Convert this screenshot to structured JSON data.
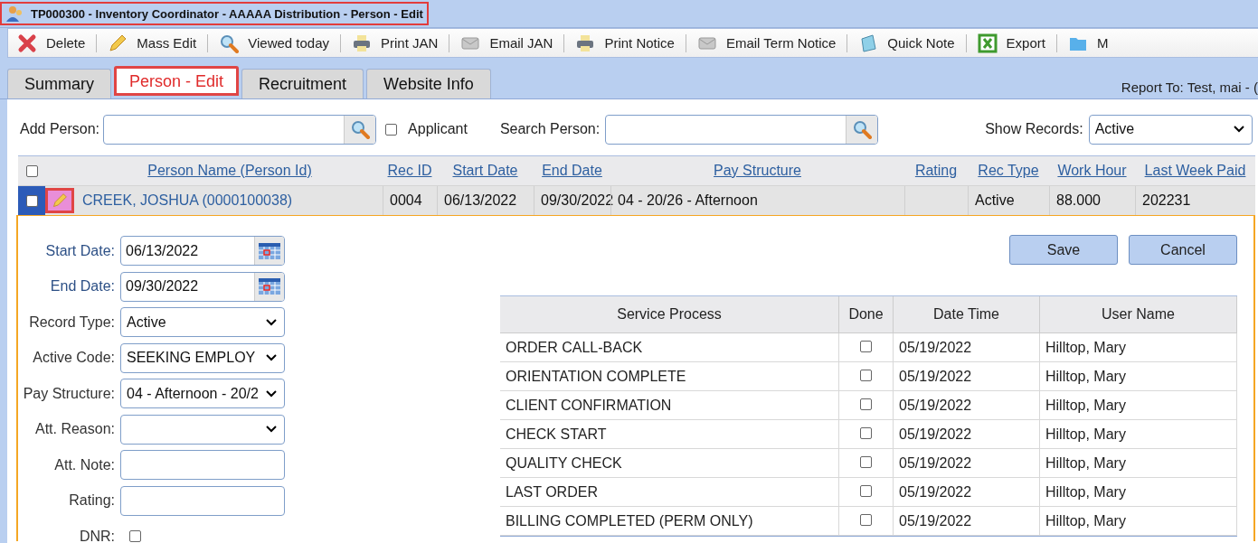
{
  "window": {
    "title": "TP000300 - Inventory Coordinator - AAAAA Distribution - Person - Edit"
  },
  "toolbar": [
    {
      "label": "Delete",
      "kind": "delete"
    },
    {
      "label": "Mass Edit",
      "kind": "edit"
    },
    {
      "label": "Viewed today",
      "kind": "search"
    },
    {
      "label": "Print JAN",
      "kind": "print"
    },
    {
      "label": "Email JAN",
      "kind": "email"
    },
    {
      "label": "Print Notice",
      "kind": "print"
    },
    {
      "label": "Email Term Notice",
      "kind": "email"
    },
    {
      "label": "Quick Note",
      "kind": "note"
    },
    {
      "label": "Export",
      "kind": "export"
    },
    {
      "label": "M",
      "kind": "folder"
    }
  ],
  "tabs": [
    {
      "label": "Summary",
      "selected": false
    },
    {
      "label": "Person - Edit",
      "selected": true
    },
    {
      "label": "Recruitment",
      "selected": false
    },
    {
      "label": "Website Info",
      "selected": false
    }
  ],
  "report_to": "Report To: Test, mai - (",
  "filters": {
    "add_person_label": "Add Person:",
    "applicant": {
      "label": "Applicant",
      "checked": false
    },
    "search_person_label": "Search Person:",
    "show_records_label": "Show Records:",
    "show_records_value": "Active"
  },
  "grid": {
    "header_checked": false,
    "columns": [
      "Person Name (Person Id)",
      "Rec ID",
      "Start Date",
      "End Date",
      "Pay Structure",
      "Rating",
      "Rec Type",
      "Work Hour",
      "Last Week Paid"
    ],
    "rows": [
      {
        "checked": false,
        "cells": [
          "CREEK, JOSHUA (0000100038)",
          "0004",
          "06/13/2022",
          "09/30/2022",
          "04 - 20/26 - Afternoon",
          "",
          "Active",
          "88.000",
          "202231"
        ]
      }
    ]
  },
  "edit_form": {
    "fields": [
      {
        "label": "Start Date:",
        "kind": "date",
        "value": "06/13/2022"
      },
      {
        "label": "End Date:",
        "kind": "date",
        "value": "09/30/2022"
      },
      {
        "label": "Record Type:",
        "kind": "select",
        "value": "Active"
      },
      {
        "label": "Active Code:",
        "kind": "select",
        "value": "SEEKING EMPLOY"
      },
      {
        "label": "Pay Structure:",
        "kind": "select",
        "value": "04 - Afternoon - 20/2"
      },
      {
        "label": "Att. Reason:",
        "kind": "select"
      },
      {
        "label": "Att. Note:",
        "kind": "text"
      },
      {
        "label": "Rating:",
        "kind": "text"
      },
      {
        "label": "DNR:",
        "kind": "checkbox",
        "checked": false
      }
    ],
    "buttons": [
      "Save",
      "Cancel"
    ]
  },
  "service_table": {
    "columns": [
      "Service Process",
      "Done",
      "Date Time",
      "User Name"
    ],
    "rows": [
      {
        "process": "ORDER CALL-BACK",
        "done": false,
        "date_time": "05/19/2022",
        "user": "Hilltop, Mary"
      },
      {
        "process": "ORIENTATION COMPLETE",
        "done": false,
        "date_time": "05/19/2022",
        "user": "Hilltop, Mary"
      },
      {
        "process": "CLIENT CONFIRMATION",
        "done": false,
        "date_time": "05/19/2022",
        "user": "Hilltop, Mary"
      },
      {
        "process": "CHECK START",
        "done": false,
        "date_time": "05/19/2022",
        "user": "Hilltop, Mary"
      },
      {
        "process": "QUALITY CHECK",
        "done": false,
        "date_time": "05/19/2022",
        "user": "Hilltop, Mary"
      },
      {
        "process": "LAST ORDER",
        "done": false,
        "date_time": "05/19/2022",
        "user": "Hilltop, Mary"
      },
      {
        "process": "BILLING COMPLETED (PERM ONLY)",
        "done": false,
        "date_time": "05/19/2022",
        "user": "Hilltop, Mary"
      }
    ]
  }
}
